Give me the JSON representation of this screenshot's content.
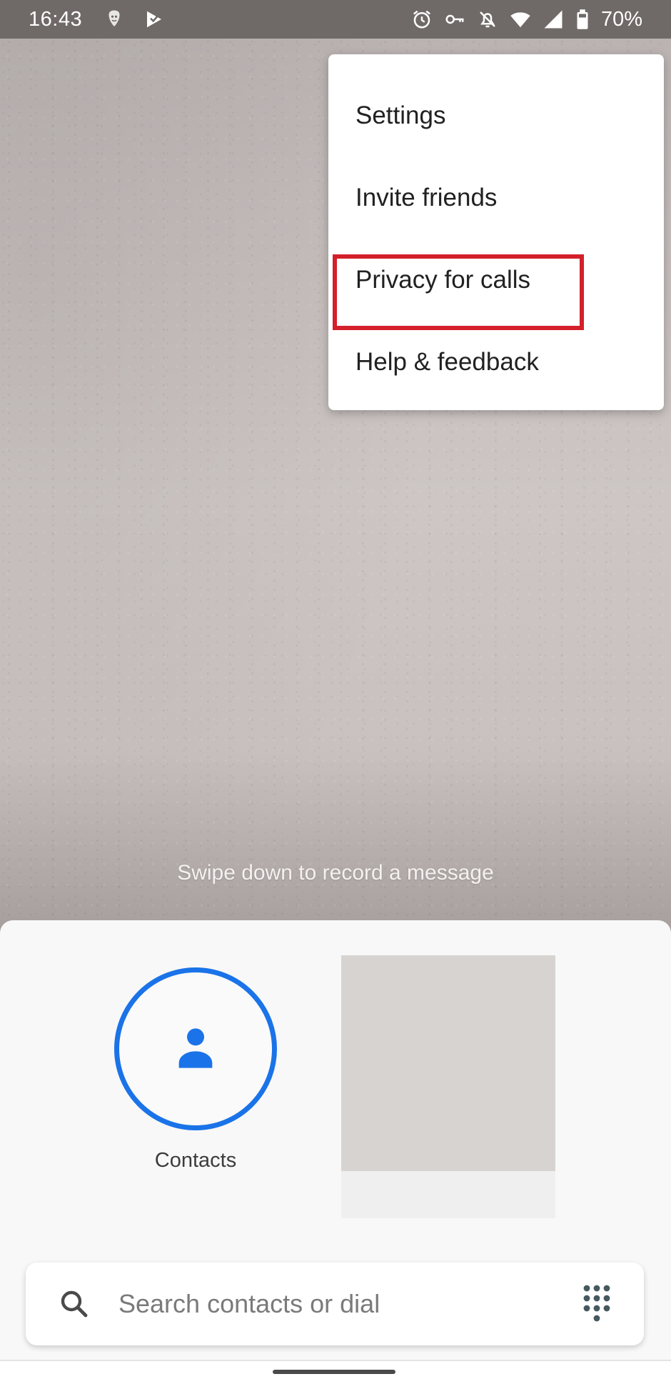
{
  "status_bar": {
    "time": "16:43",
    "left_icons": [
      "vpn-shield-icon",
      "play-store-icon"
    ],
    "right_icons": [
      "alarm-icon",
      "vpn-key-icon",
      "notifications-off-icon",
      "wifi-icon",
      "cellular-signal-icon",
      "battery-icon"
    ],
    "battery_percent": "70%"
  },
  "overflow_menu": {
    "items": [
      {
        "label": "Settings"
      },
      {
        "label": "Invite friends"
      },
      {
        "label": "Privacy for calls",
        "highlighted": true
      },
      {
        "label": "Help & feedback"
      }
    ],
    "highlight_color": "#d3202a"
  },
  "swipe_hint": "Swipe down to record a message",
  "bottom_sheet": {
    "contacts": {
      "label": "Contacts",
      "icon": "person-icon",
      "accent_color": "#1a73e8"
    }
  },
  "search": {
    "placeholder": "Search contacts or dial",
    "value": ""
  }
}
